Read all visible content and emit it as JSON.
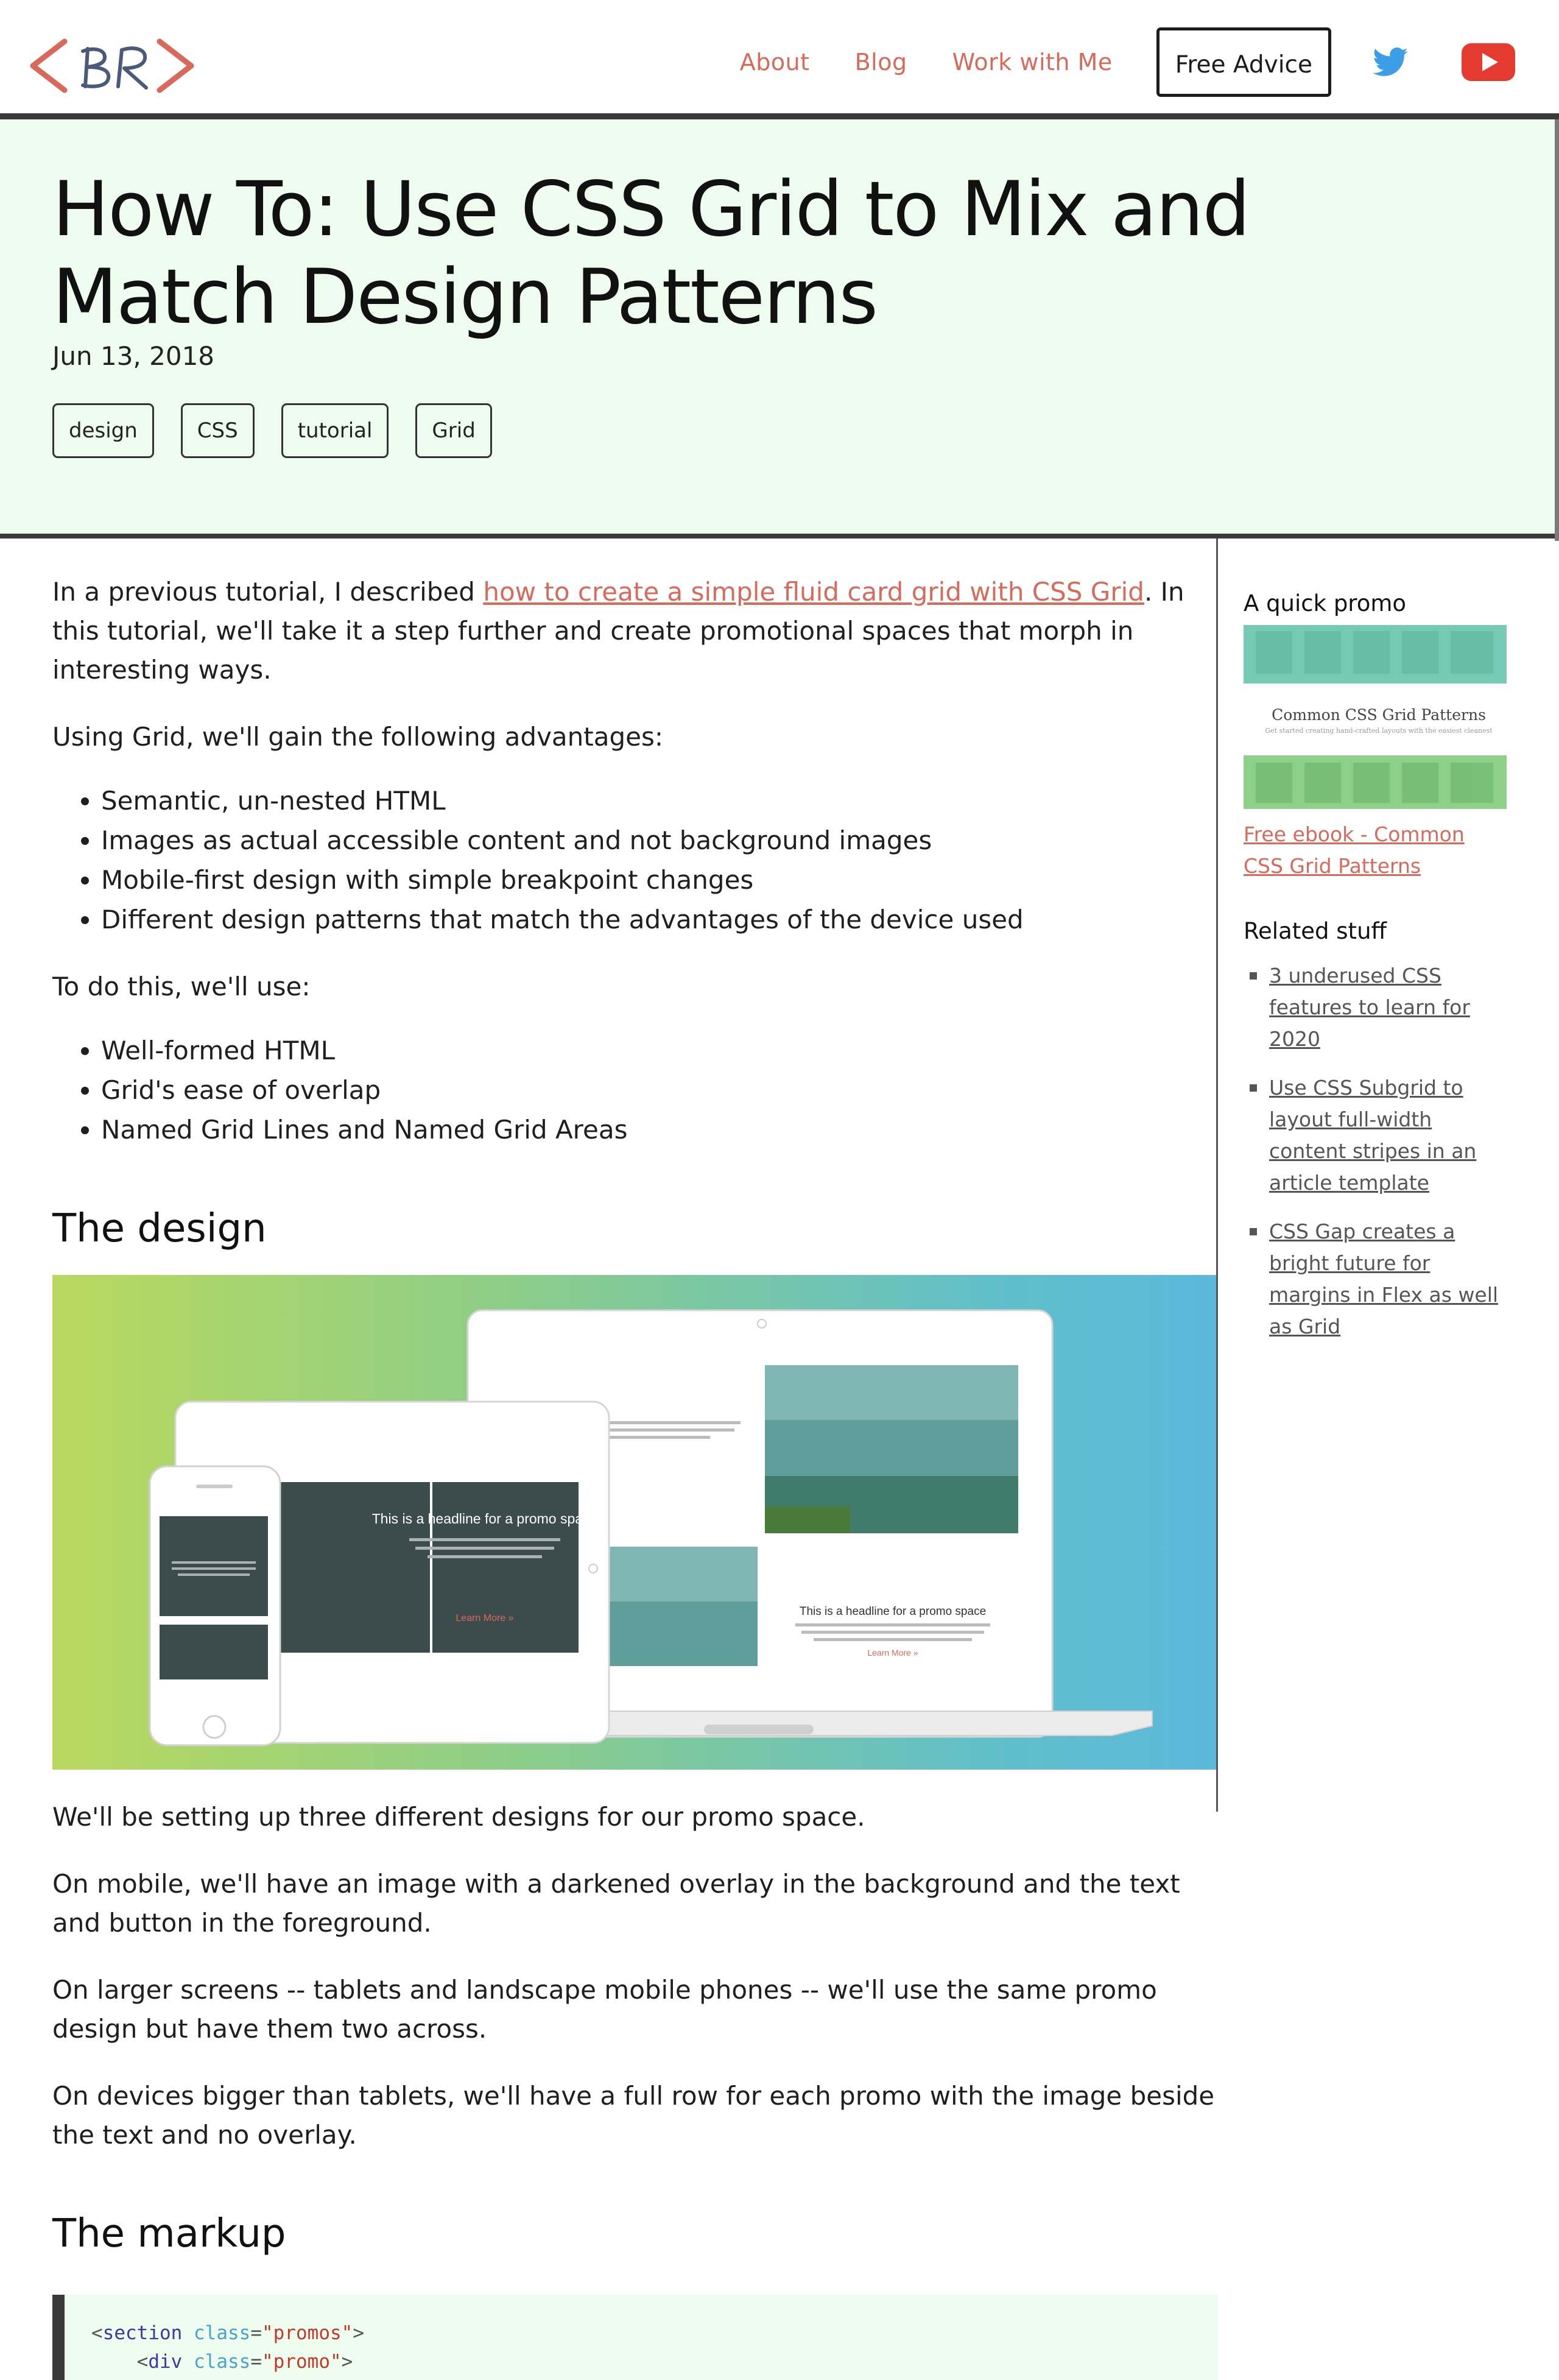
{
  "header": {
    "logo_text": "<BR>",
    "nav": [
      {
        "label": "About"
      },
      {
        "label": "Blog"
      },
      {
        "label": "Work with Me"
      }
    ],
    "cta_label": "Free Advice",
    "icons": [
      "twitter-icon",
      "youtube-icon"
    ],
    "accent_color": "#d9695a"
  },
  "hero": {
    "title": "How To: Use CSS Grid to Mix and Match Design Patterns",
    "date": "Jun 13, 2018",
    "tags": [
      "design",
      "CSS",
      "tutorial",
      "Grid"
    ],
    "background_color": "#eefcef"
  },
  "article": {
    "intro_before_link": "In a previous tutorial, I described ",
    "intro_link": "how to create a simple fluid card grid with CSS Grid",
    "intro_after_link": ". In this tutorial, we'll take it a step further and create promotional spaces that morph in interesting ways.",
    "advantages_intro": "Using Grid, we'll gain the following advantages:",
    "advantages": [
      "Semantic, un-nested HTML",
      "Images as actual accessible content and not background images",
      "Mobile-first design with simple breakpoint changes",
      "Different design patterns that match the advantages of the device used"
    ],
    "tools_intro": "To do this, we'll use:",
    "tools": [
      "Well-formed HTML",
      "Grid's ease of overlap",
      "Named Grid Lines and Named Grid Areas"
    ],
    "design_heading": "The design",
    "image_promo_headline": "This is a headline for a promo space",
    "image_learn_more": "Learn More »",
    "paragraphs": [
      "We'll be setting up three different designs for our promo space.",
      "On mobile, we'll have an image with a darkened overlay in the background and the text and button in the foreground.",
      "On larger screens -- tablets and landscape mobile phones -- we'll use the same promo design but have them two across.",
      "On devices bigger than tablets, we'll have a full row for each promo with the image beside the text and no overlay."
    ],
    "markup_heading": "The markup",
    "code": {
      "line1_tag": "section",
      "line1_attr": "class",
      "line1_val": "\"promos\"",
      "line2_tag": "div",
      "line2_attr": "class",
      "line2_val": "\"promo\""
    }
  },
  "sidebar": {
    "promo_heading": "A quick promo",
    "promo_image_title": "Common CSS Grid Patterns",
    "promo_image_subtitle": "Get started creating hand-crafted layouts with the easiest cleanest",
    "promo_link": "Free ebook - Common CSS Grid Patterns",
    "related_heading": "Related stuff",
    "related": [
      "3 underused CSS features to learn for 2020",
      "Use CSS Subgrid to layout full-width content stripes in an article template",
      "CSS Gap creates a bright future for margins in Flex as well as Grid"
    ]
  }
}
